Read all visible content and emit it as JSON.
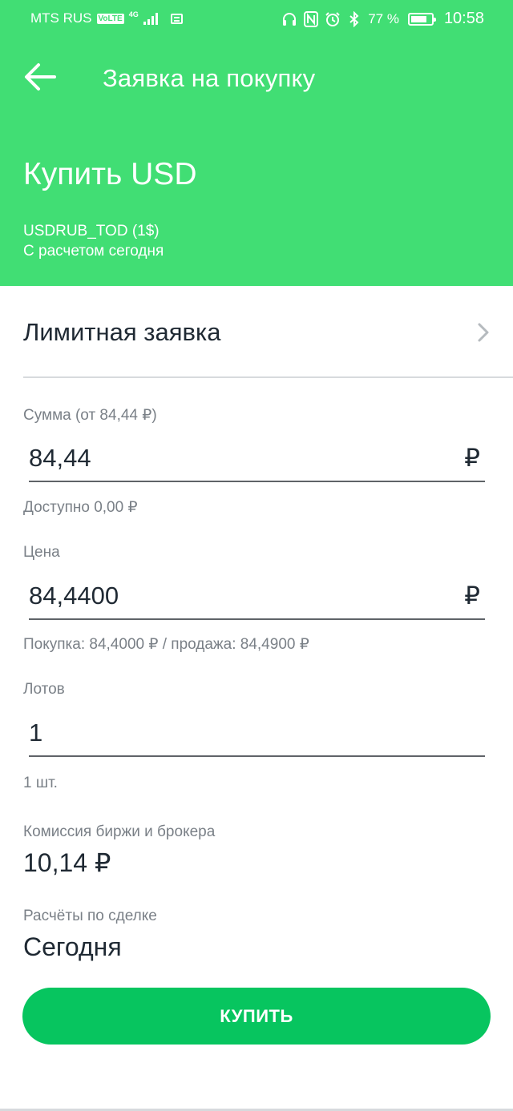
{
  "status_bar": {
    "carrier": "MTS RUS",
    "volte": "VoLTE",
    "network": "4G",
    "battery_percent": "77 %",
    "time": "10:58"
  },
  "header": {
    "title": "Заявка на покупку",
    "buy_title": "Купить USD",
    "ticker": "USDRUB_TOD (1$)",
    "settlement_note": "С расчетом сегодня"
  },
  "order_type": {
    "label": "Лимитная заявка"
  },
  "amount": {
    "label": "Сумма (от 84,44  ₽)",
    "value": "84,44",
    "unit": "₽",
    "available": "Доступно 0,00  ₽"
  },
  "price": {
    "label": "Цена",
    "value": "84,4400",
    "unit": "₽",
    "hint": "Покупка: 84,4000 ₽ / продажа: 84,4900 ₽"
  },
  "lots": {
    "label": "Лотов",
    "value": "1",
    "hint": "1 шт."
  },
  "commission": {
    "label": "Комиссия биржи и брокера",
    "value": "10,14  ₽"
  },
  "settlement": {
    "label": "Расчёты по сделке",
    "value": "Сегодня"
  },
  "buy_button": {
    "label": "КУПИТЬ"
  },
  "colors": {
    "header_green": "#41de74",
    "button_green": "#07c55f"
  }
}
